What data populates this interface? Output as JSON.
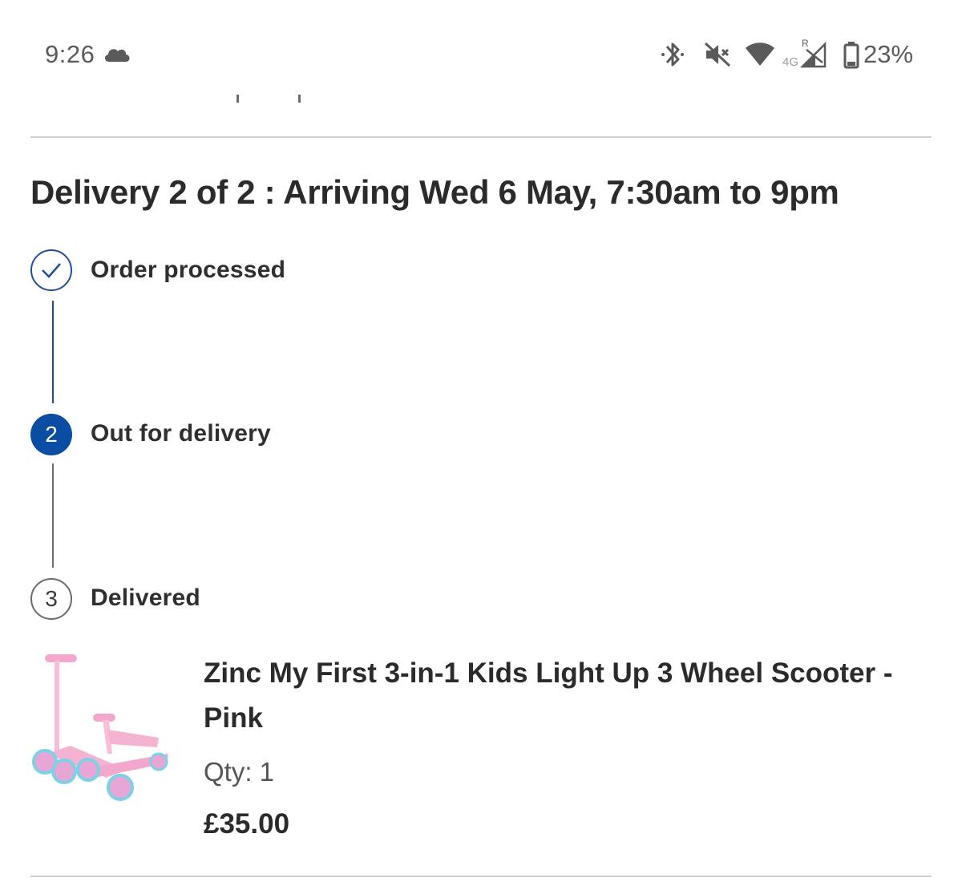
{
  "status_bar": {
    "time": "9:26",
    "weather_icon": "cloud-icon",
    "icons": [
      "bluetooth-icon",
      "mute-icon",
      "wifi-icon",
      "signal-icon",
      "battery-icon"
    ],
    "network_label": "4G",
    "roaming_label": "R",
    "battery": "23%"
  },
  "delivery": {
    "title": "Delivery 2 of 2 : Arriving Wed 6 May, 7:30am to 9pm",
    "steps": [
      {
        "number": "1",
        "label": "Order processed",
        "state": "done"
      },
      {
        "number": "2",
        "label": "Out for delivery",
        "state": "current"
      },
      {
        "number": "3",
        "label": "Delivered",
        "state": "pending"
      }
    ],
    "colors": {
      "accent": "#0a4da2",
      "done_border": "#1f4f9c",
      "pending_border": "#6b6b6b"
    }
  },
  "product": {
    "name": "Zinc My First 3-in-1 Kids Light Up 3 Wheel Scooter - Pink",
    "qty": "Qty: 1",
    "price": "£35.00"
  }
}
